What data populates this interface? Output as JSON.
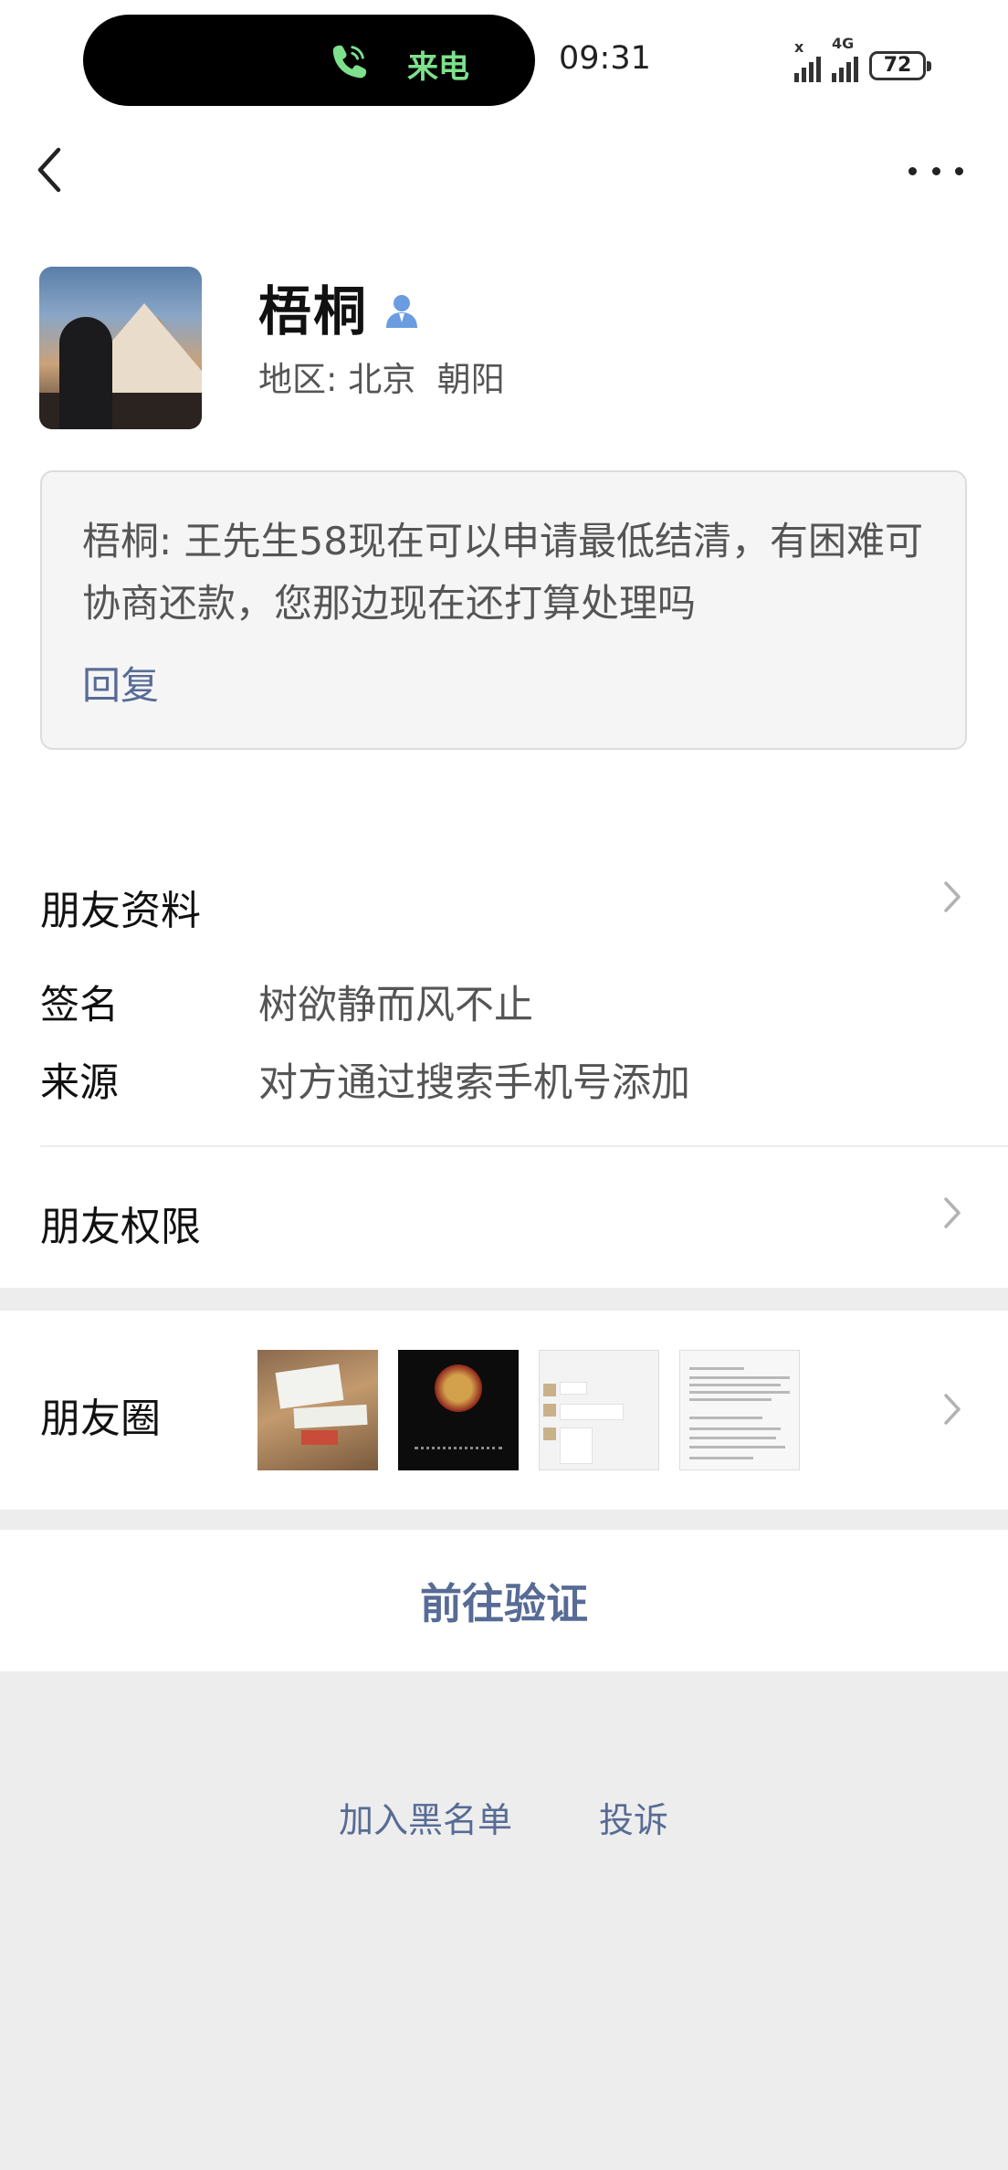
{
  "status_bar": {
    "call_label": "来电",
    "time": "09:31",
    "network": "4G",
    "battery": "72"
  },
  "contact": {
    "name": "梧桐",
    "region_label": "地区:",
    "region_value": "北京  朝阳"
  },
  "message_card": {
    "text": "梧桐: 王先生58现在可以申请最低结清，有困难可协商还款，您那边现在还打算处理吗",
    "reply_label": "回复"
  },
  "friend_info": {
    "title": "朋友资料",
    "signature_label": "签名",
    "signature_value": "树欲静而风不止",
    "source_label": "来源",
    "source_value": "对方通过搜索手机号添加"
  },
  "permissions": {
    "title": "朋友权限"
  },
  "moments": {
    "title": "朋友圈"
  },
  "verify": {
    "label": "前往验证"
  },
  "footer": {
    "blacklist_label": "加入黑名单",
    "report_label": "投诉"
  },
  "colors": {
    "link": "#576b95",
    "call_green": "#7ee08c",
    "page_bg": "#ededed"
  }
}
